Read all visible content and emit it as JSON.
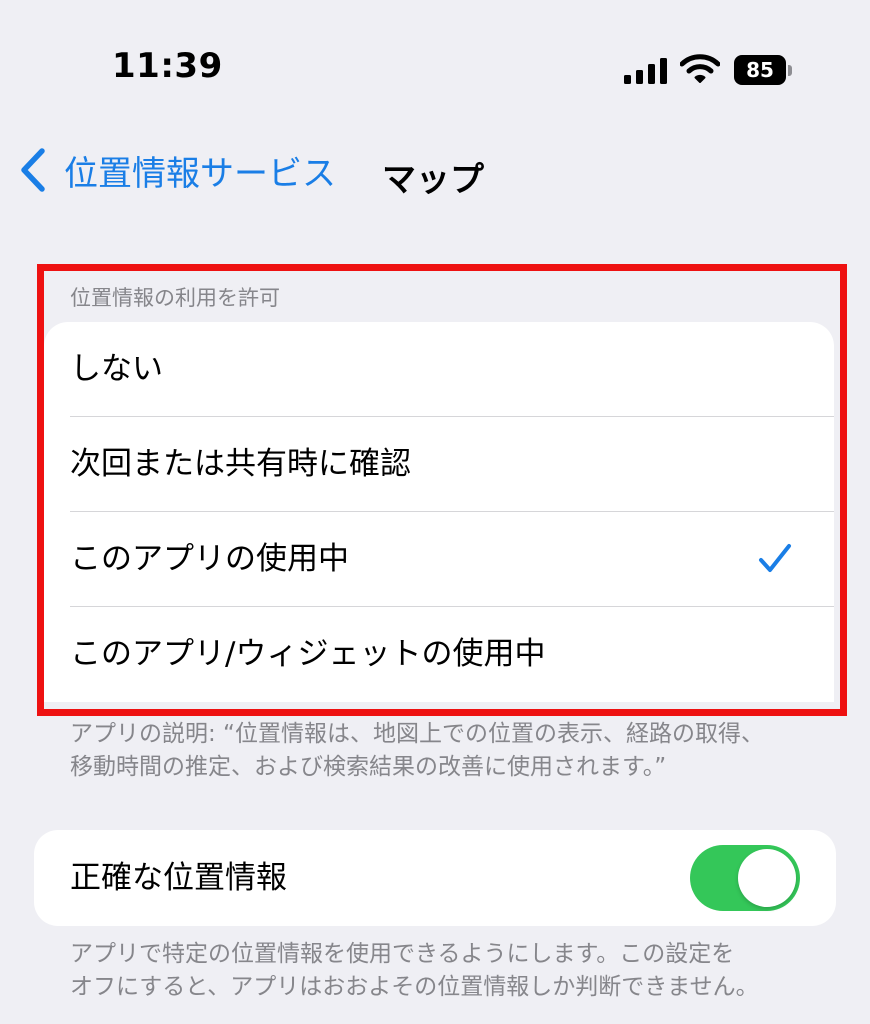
{
  "status_bar": {
    "time": "11:39",
    "battery_level": "85",
    "icons": [
      "signal-icon",
      "wifi-icon",
      "battery-icon"
    ]
  },
  "nav": {
    "back_label": "位置情報サービス",
    "back_icon": "chevron-left-icon",
    "title": "マップ"
  },
  "location_access": {
    "header": "位置情報の利用を許可",
    "options": [
      {
        "label": "しない",
        "selected": false
      },
      {
        "label": "次回または共有時に確認",
        "selected": false
      },
      {
        "label": "このアプリの使用中",
        "selected": true
      },
      {
        "label": "このアプリ/ウィジェットの使用中",
        "selected": false
      }
    ],
    "description_line1": "アプリの説明: “位置情報は、地図上での位置の表示、経路の取得、",
    "description_line2": "移動時間の推定、および検索結果の改善に使用されます。”"
  },
  "precise_location": {
    "label": "正確な位置情報",
    "enabled": true,
    "description_line1": "アプリで特定の位置情報を使用できるようにします。この設定を",
    "description_line2": "オフにすると、アプリはおおよその位置情報しか判断できません。"
  },
  "colors": {
    "background": "#efeff4",
    "accent_blue": "#1a7ee6",
    "toggle_on": "#34c759",
    "highlight_red": "#ee1111",
    "secondary_text": "#86868b"
  }
}
